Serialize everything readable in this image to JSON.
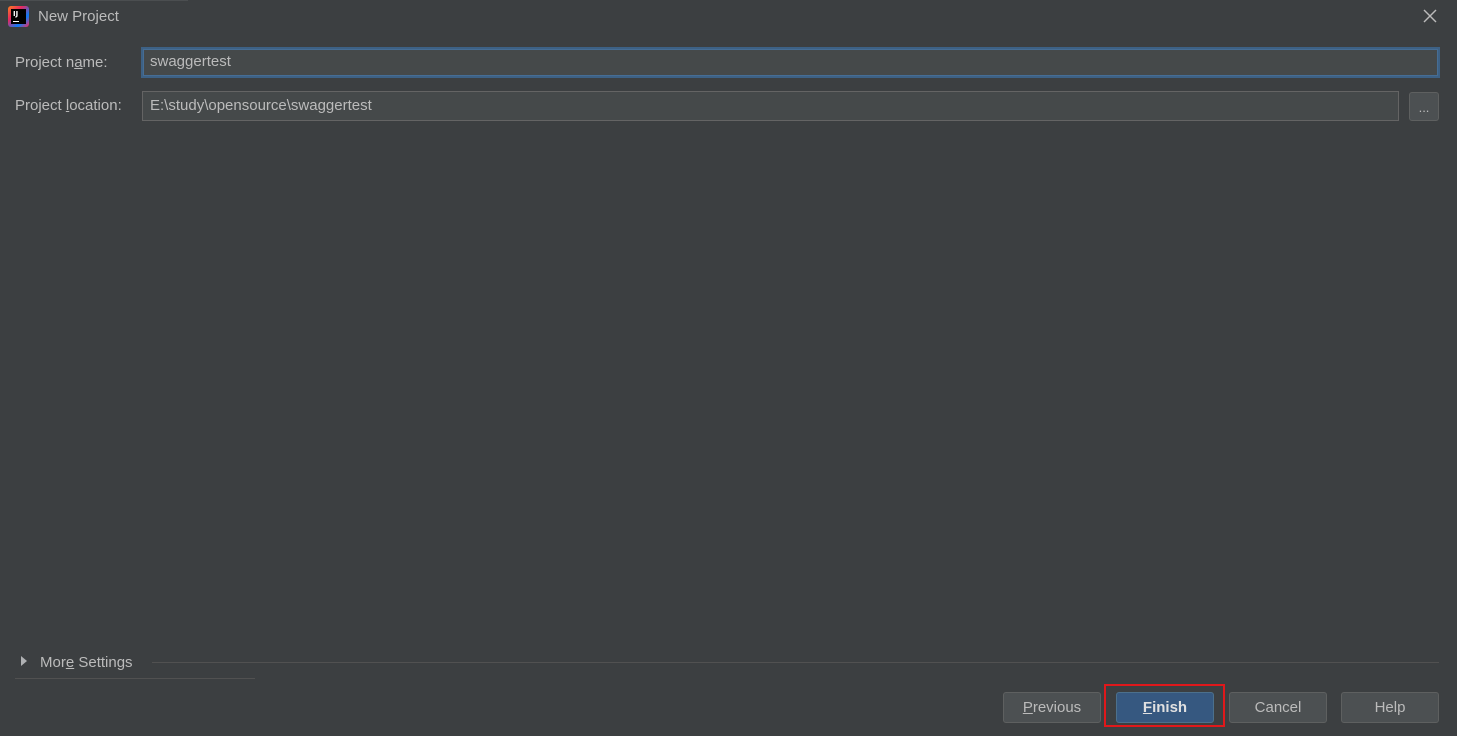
{
  "window": {
    "title": "New Project",
    "app_icon": "intellij-idea-icon",
    "close_icon": "close-icon"
  },
  "form": {
    "project_name": {
      "label_pre": "Project n",
      "label_mnemonic": "a",
      "label_post": "me:",
      "value": "swaggertest"
    },
    "project_location": {
      "label_pre": "Project ",
      "label_mnemonic": "l",
      "label_post": "ocation:",
      "value": "E:\\study\\opensource\\swaggertest",
      "browse_label": "..."
    }
  },
  "more_settings": {
    "label_pre": "Mor",
    "label_mnemonic": "e",
    "label_post": " Settings",
    "expanded": false
  },
  "buttons": {
    "previous": {
      "mnemonic": "P",
      "rest": "revious"
    },
    "finish": {
      "mnemonic": "F",
      "rest": "inish"
    },
    "cancel": {
      "label": "Cancel"
    },
    "help": {
      "label": "Help"
    }
  },
  "colors": {
    "background": "#3c3f41",
    "input_bg": "#45494a",
    "primary_button": "#365880",
    "focus_border": "#3d6185",
    "highlight_box": "#e0181b"
  }
}
